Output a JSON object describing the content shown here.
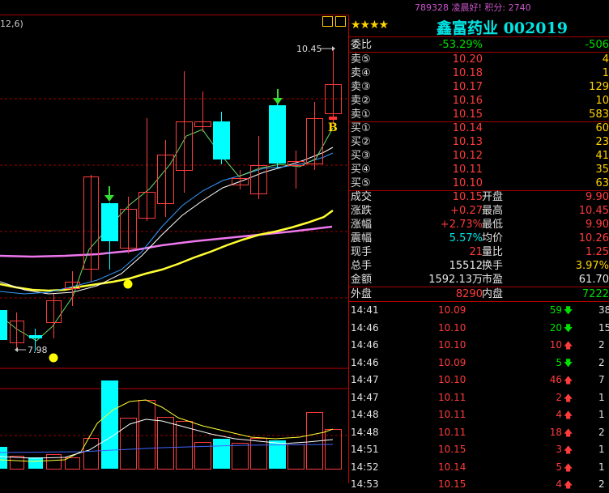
{
  "top_bar": {
    "message": "789328 凌晨好! 积分: 2740",
    "message_color": "#cc55cc"
  },
  "chart": {
    "period_label": "12,6)",
    "high_label": "10.45",
    "low_label": "7.98",
    "b_marker": "B",
    "colors": {
      "up": "#ff3c3c",
      "down": "#00ffff",
      "ma_yellow": "#ffff33",
      "ma_magenta": "#ee77ee",
      "ma_blue": "#3399ff",
      "ma_green": "#66dd66",
      "grid": "#a00000",
      "arrow": "#33dd33"
    }
  },
  "quote": {
    "stars": "★★★★",
    "stock_title": "鑫富药业 002019",
    "weibi": {
      "label": "委比",
      "value": "-53.29%",
      "extra": "-506"
    },
    "sell": [
      {
        "label": "卖⑤",
        "price": "10.20",
        "vol": "4"
      },
      {
        "label": "卖④",
        "price": "10.18",
        "vol": "1"
      },
      {
        "label": "卖③",
        "price": "10.17",
        "vol": "129"
      },
      {
        "label": "卖②",
        "price": "10.16",
        "vol": "10"
      },
      {
        "label": "卖①",
        "price": "10.15",
        "vol": "583"
      }
    ],
    "buy": [
      {
        "label": "买①",
        "price": "10.14",
        "vol": "60"
      },
      {
        "label": "买②",
        "price": "10.13",
        "vol": "23"
      },
      {
        "label": "买③",
        "price": "10.12",
        "vol": "41"
      },
      {
        "label": "买④",
        "price": "10.11",
        "vol": "35"
      },
      {
        "label": "买⑤",
        "price": "10.10",
        "vol": "63"
      }
    ],
    "stats": [
      {
        "l1": "成交",
        "v1": "10.15",
        "l2": "开盘",
        "v2": "9.90",
        "c1": "red",
        "c2": "red"
      },
      {
        "l1": "涨跌",
        "v1": "+0.27",
        "l2": "最高",
        "v2": "10.45",
        "c1": "red",
        "c2": "red"
      },
      {
        "l1": "涨幅",
        "v1": "+2.73%",
        "l2": "最低",
        "v2": "9.90",
        "c1": "red",
        "c2": "red"
      },
      {
        "l1": "震幅",
        "v1": "5.57%",
        "l2": "均价",
        "v2": "10.26",
        "c1": "cyan",
        "c2": "red"
      },
      {
        "l1": "现手",
        "v1": "21",
        "l2": "量比",
        "v2": "1.25",
        "c1": "red",
        "c2": "red"
      },
      {
        "l1": "总手",
        "v1": "15512",
        "l2": "换手",
        "v2": "3.97%",
        "c1": "white",
        "c2": "yellow"
      },
      {
        "l1": "金额",
        "v1": "1592.13万",
        "l2": "市盈",
        "v2": "61.70",
        "c1": "white",
        "c2": "white"
      }
    ],
    "outer": {
      "l1": "外盘",
      "v1": "8290",
      "l2": "内盘",
      "v2": "7222"
    }
  },
  "ticks": [
    {
      "time": "14:41",
      "price": "10.09",
      "vol": "59",
      "dir": "down",
      "c": "38"
    },
    {
      "time": "14:46",
      "price": "10.10",
      "vol": "20",
      "dir": "down",
      "c": "15"
    },
    {
      "time": "14:46",
      "price": "10.10",
      "vol": "10",
      "dir": "up",
      "c": "2"
    },
    {
      "time": "14:46",
      "price": "10.09",
      "vol": "5",
      "dir": "down",
      "c": "2"
    },
    {
      "time": "14:47",
      "price": "10.10",
      "vol": "46",
      "dir": "up",
      "c": "7"
    },
    {
      "time": "14:47",
      "price": "10.11",
      "vol": "2",
      "dir": "up",
      "c": "1"
    },
    {
      "time": "14:48",
      "price": "10.11",
      "vol": "4",
      "dir": "up",
      "c": "1"
    },
    {
      "time": "14:48",
      "price": "10.11",
      "vol": "18",
      "dir": "up",
      "c": "2"
    },
    {
      "time": "14:51",
      "price": "10.15",
      "vol": "3",
      "dir": "up",
      "c": "1"
    },
    {
      "time": "14:52",
      "price": "10.14",
      "vol": "5",
      "dir": "up",
      "c": "1"
    },
    {
      "time": "14:53",
      "price": "10.15",
      "vol": "4",
      "dir": "up",
      "c": "2"
    }
  ],
  "arrows": {
    "up": "🡅",
    "down": "🡇",
    "up_color": "#ff3c3c",
    "down_color": "#00e000"
  }
}
